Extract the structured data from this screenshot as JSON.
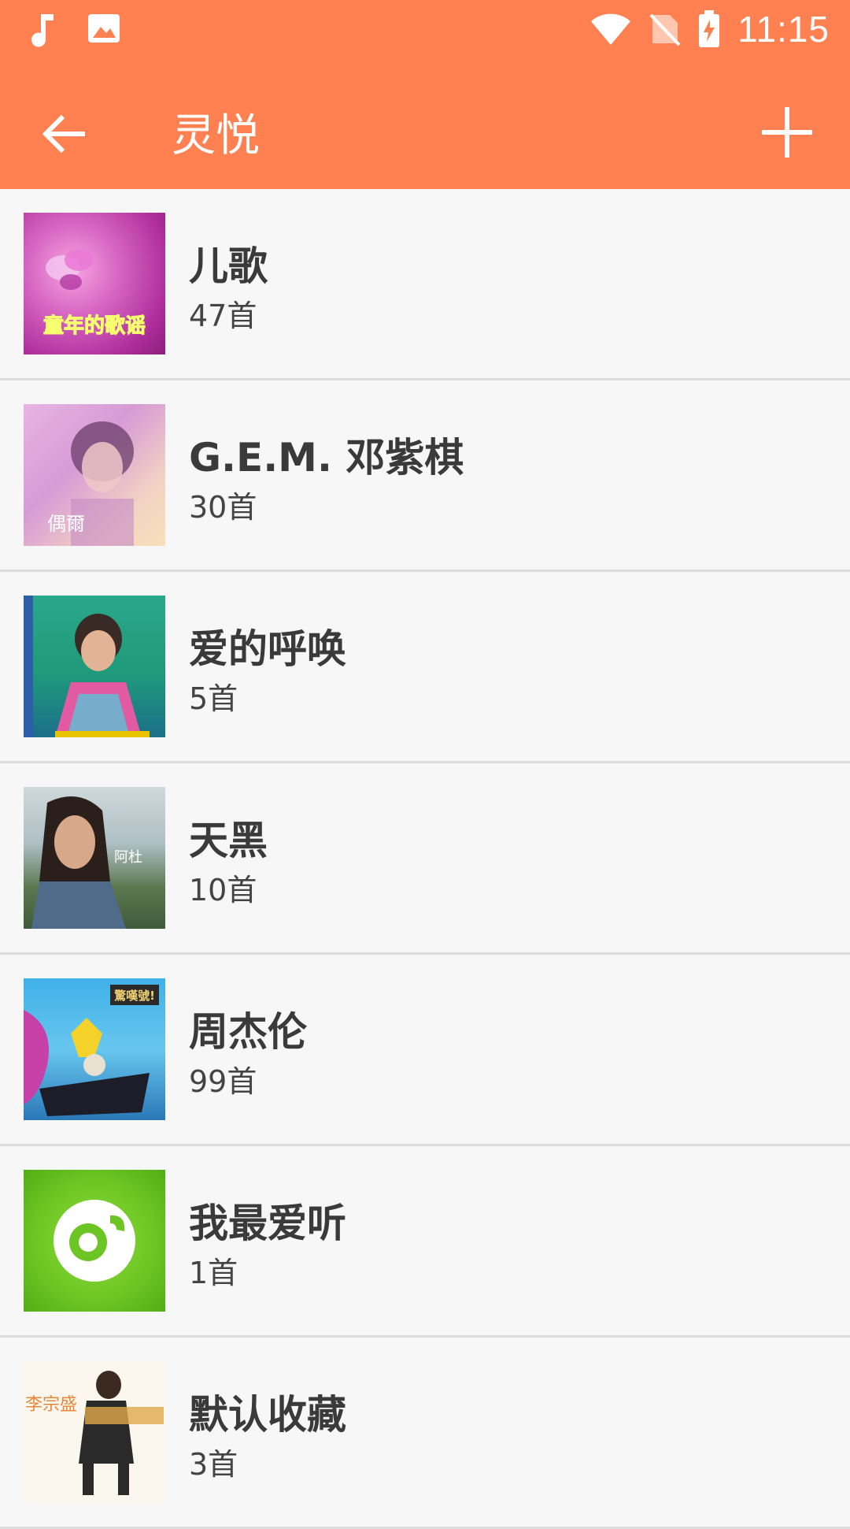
{
  "status_bar": {
    "time": "11:15"
  },
  "app_bar": {
    "title": "灵悦"
  },
  "playlists": [
    {
      "title": "儿歌",
      "count": "47首",
      "cover_text": "童年的歌谣"
    },
    {
      "title": "G.E.M. 邓紫棋",
      "count": "30首",
      "cover_text": "偶爾"
    },
    {
      "title": "爱的呼唤",
      "count": "5首"
    },
    {
      "title": "天黑",
      "count": "10首",
      "cover_text": "阿杜"
    },
    {
      "title": "周杰伦",
      "count": "99首",
      "cover_text": "驚嘆號!"
    },
    {
      "title": "我最爱听",
      "count": "1首"
    },
    {
      "title": "默认收藏",
      "count": "3首",
      "cover_text": "李宗盛"
    }
  ],
  "colors": {
    "accent": "#ff8050",
    "text": "#3a3a3a",
    "divider": "#dcdcdc"
  }
}
